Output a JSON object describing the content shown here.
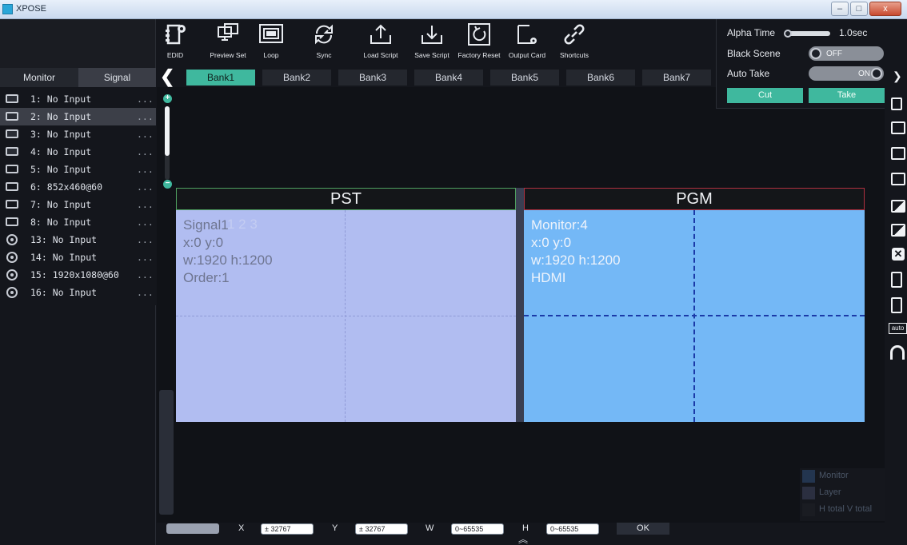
{
  "window": {
    "title": "XPOSE",
    "controls": [
      "–",
      "□",
      "x"
    ]
  },
  "left_panel": {
    "tabs": [
      {
        "label": "Monitor"
      },
      {
        "label": "Signal"
      }
    ],
    "inputs": [
      {
        "label": "1: No Input",
        "more": "...",
        "port": "hdmi"
      },
      {
        "label": "2: No Input",
        "more": "...",
        "port": "hdmi",
        "selected": true
      },
      {
        "label": "3: No Input",
        "more": "...",
        "port": "hdmi"
      },
      {
        "label": "4: No Input",
        "more": "...",
        "port": "hdmi"
      },
      {
        "label": "5: No Input",
        "more": "...",
        "port": "dvi"
      },
      {
        "label": "6: 852x460@60",
        "more": "...",
        "port": "dvi"
      },
      {
        "label": "7: No Input",
        "more": "...",
        "port": "dvi"
      },
      {
        "label": "8: No Input",
        "more": "...",
        "port": "dvi"
      },
      {
        "label": "13: No Input",
        "more": "...",
        "port": "sdi"
      },
      {
        "label": "14: No Input",
        "more": "...",
        "port": "sdi"
      },
      {
        "label": "15: 1920x1080@60",
        "more": "...",
        "port": "sdi"
      },
      {
        "label": "16: No Input",
        "more": "...",
        "port": "sdi"
      }
    ]
  },
  "toolbar": {
    "items": [
      {
        "label": "EDID",
        "icon": "edid-icon"
      },
      {
        "label": "Preview Set",
        "icon": "preview-set-icon"
      },
      {
        "label": "Loop",
        "icon": "loop-icon"
      },
      {
        "label": "Sync",
        "icon": "sync-icon"
      },
      {
        "label": "Load Script",
        "icon": "load-script-icon"
      },
      {
        "label": "Save Script",
        "icon": "save-script-icon"
      },
      {
        "label": "Factory Reset",
        "icon": "factory-reset-icon"
      },
      {
        "label": "Output Card",
        "icon": "output-card-icon"
      },
      {
        "label": "Shortcuts",
        "icon": "shortcuts-icon"
      }
    ]
  },
  "banks": [
    {
      "label": "Bank1",
      "active": true
    },
    {
      "label": "Bank2"
    },
    {
      "label": "Bank3"
    },
    {
      "label": "Bank4"
    },
    {
      "label": "Bank5"
    },
    {
      "label": "Bank6"
    },
    {
      "label": "Bank7"
    }
  ],
  "preview": {
    "pst_title": "PST",
    "pgm_title": "PGM",
    "pst_lines": [
      "Signal1",
      "x:0  y:0",
      "w:1920  h:1200",
      "Order:1"
    ],
    "pst_ghost": "1 2 3",
    "pgm_lines": [
      "Monitor:4",
      "x:0  y:0",
      "w:1920  h:1200",
      "HDMI"
    ]
  },
  "controls": {
    "alpha_time_label": "Alpha Time",
    "alpha_time_value": "1.0sec",
    "black_scene_label": "Black Scene",
    "black_scene_state": "OFF",
    "auto_take_label": "Auto Take",
    "auto_take_state": "ON",
    "cut_label": "Cut",
    "take_label": "Take"
  },
  "legend": [
    {
      "label": "Monitor",
      "color": "#23354f"
    },
    {
      "label": "Layer",
      "color": "#2b2f40"
    },
    {
      "label": "H total V total",
      "color": "#1a1c22"
    }
  ],
  "bottom": {
    "x_label": "X",
    "x_placeholder": "± 32767",
    "y_label": "Y",
    "y_placeholder": "± 32767",
    "w_label": "W",
    "w_placeholder": "0~65535",
    "h_label": "H",
    "h_placeholder": "0~65535",
    "ok_label": "OK"
  },
  "right_icons": [
    "layer-icon",
    "window-icon",
    "window-alt-icon",
    "display-icon",
    "image-icon",
    "image-add-icon",
    "close-box-icon",
    "copy-icon",
    "page-icon",
    "auto-icon",
    "magnet-icon"
  ]
}
